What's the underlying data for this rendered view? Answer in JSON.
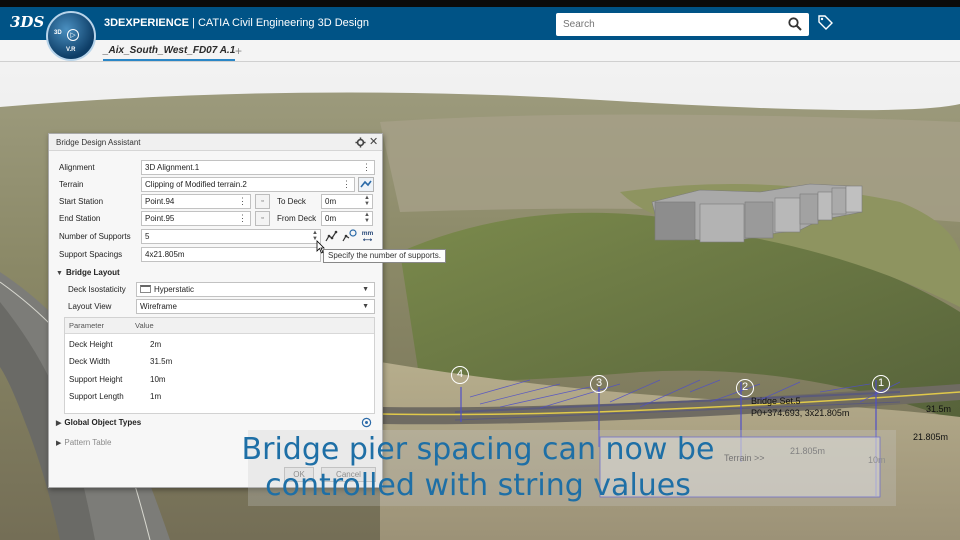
{
  "header": {
    "app_brand": "3DEXPERIENCE",
    "app_separator": " | ",
    "app_name": "CATIA Civil Engineering 3D Design",
    "compass_top": "3D",
    "compass_bottom": "V.R",
    "search_placeholder": "Search"
  },
  "tabs": [
    {
      "label": "_Aix_South_West_FD07 A.1",
      "active": true
    }
  ],
  "tab_add": "+",
  "dialog": {
    "title": "Bridge Design Assistant",
    "alignment_label": "Alignment",
    "alignment_value": "3D Alignment.1",
    "terrain_label": "Terrain",
    "terrain_value": "Clipping of Modified terrain.2",
    "start_station_label": "Start Station",
    "start_station_value": "Point.94",
    "end_station_label": "End Station",
    "end_station_value": "Point.95",
    "to_deck_label": "To Deck",
    "to_deck_value": "0m",
    "from_deck_label": "From Deck",
    "from_deck_value": "0m",
    "supports_label": "Number of Supports",
    "supports_value": "5",
    "spacings_label": "Support Spacings",
    "spacings_value": "4x21.805m",
    "tooltip": "Specify the number of supports.",
    "bridge_layout_label": "Bridge Layout",
    "deck_isostaticity_label": "Deck Isostaticity",
    "deck_isostaticity_value": "Hyperstatic",
    "layout_view_label": "Layout View",
    "layout_view_value": "Wireframe",
    "param_header": "Parameter",
    "value_header": "Value",
    "params": [
      {
        "name": "Deck Height",
        "value": "2m"
      },
      {
        "name": "Deck Width",
        "value": "31.5m"
      },
      {
        "name": "Support Height",
        "value": "10m"
      },
      {
        "name": "Support Length",
        "value": "1m"
      }
    ],
    "global_object_types_label": "Global Object Types",
    "pattern_table_label": "Pattern Table",
    "ok_label": "OK",
    "cancel_label": "Cancel",
    "mm_label": "mm"
  },
  "scene": {
    "pier_numbers": [
      "4",
      "3",
      "2",
      "1"
    ],
    "bridge_set_label": "Bridge Set.5",
    "bridge_set_formula": "P0+374.693, 3x21.805m",
    "dim_top": "31.5m",
    "dim_bottom": "21.805m",
    "terrain_tag": "Terrain >>",
    "dim_mid": "21.805m",
    "height_tag": "10m"
  },
  "caption": {
    "line1": "Bridge pier spacing can now be",
    "line2": "controlled with string values"
  },
  "colors": {
    "header_blue": "#005386",
    "caption_blue": "#1e6fa6",
    "tab_underline": "#2a86c6",
    "annotation_blue": "#4f4fc8"
  }
}
